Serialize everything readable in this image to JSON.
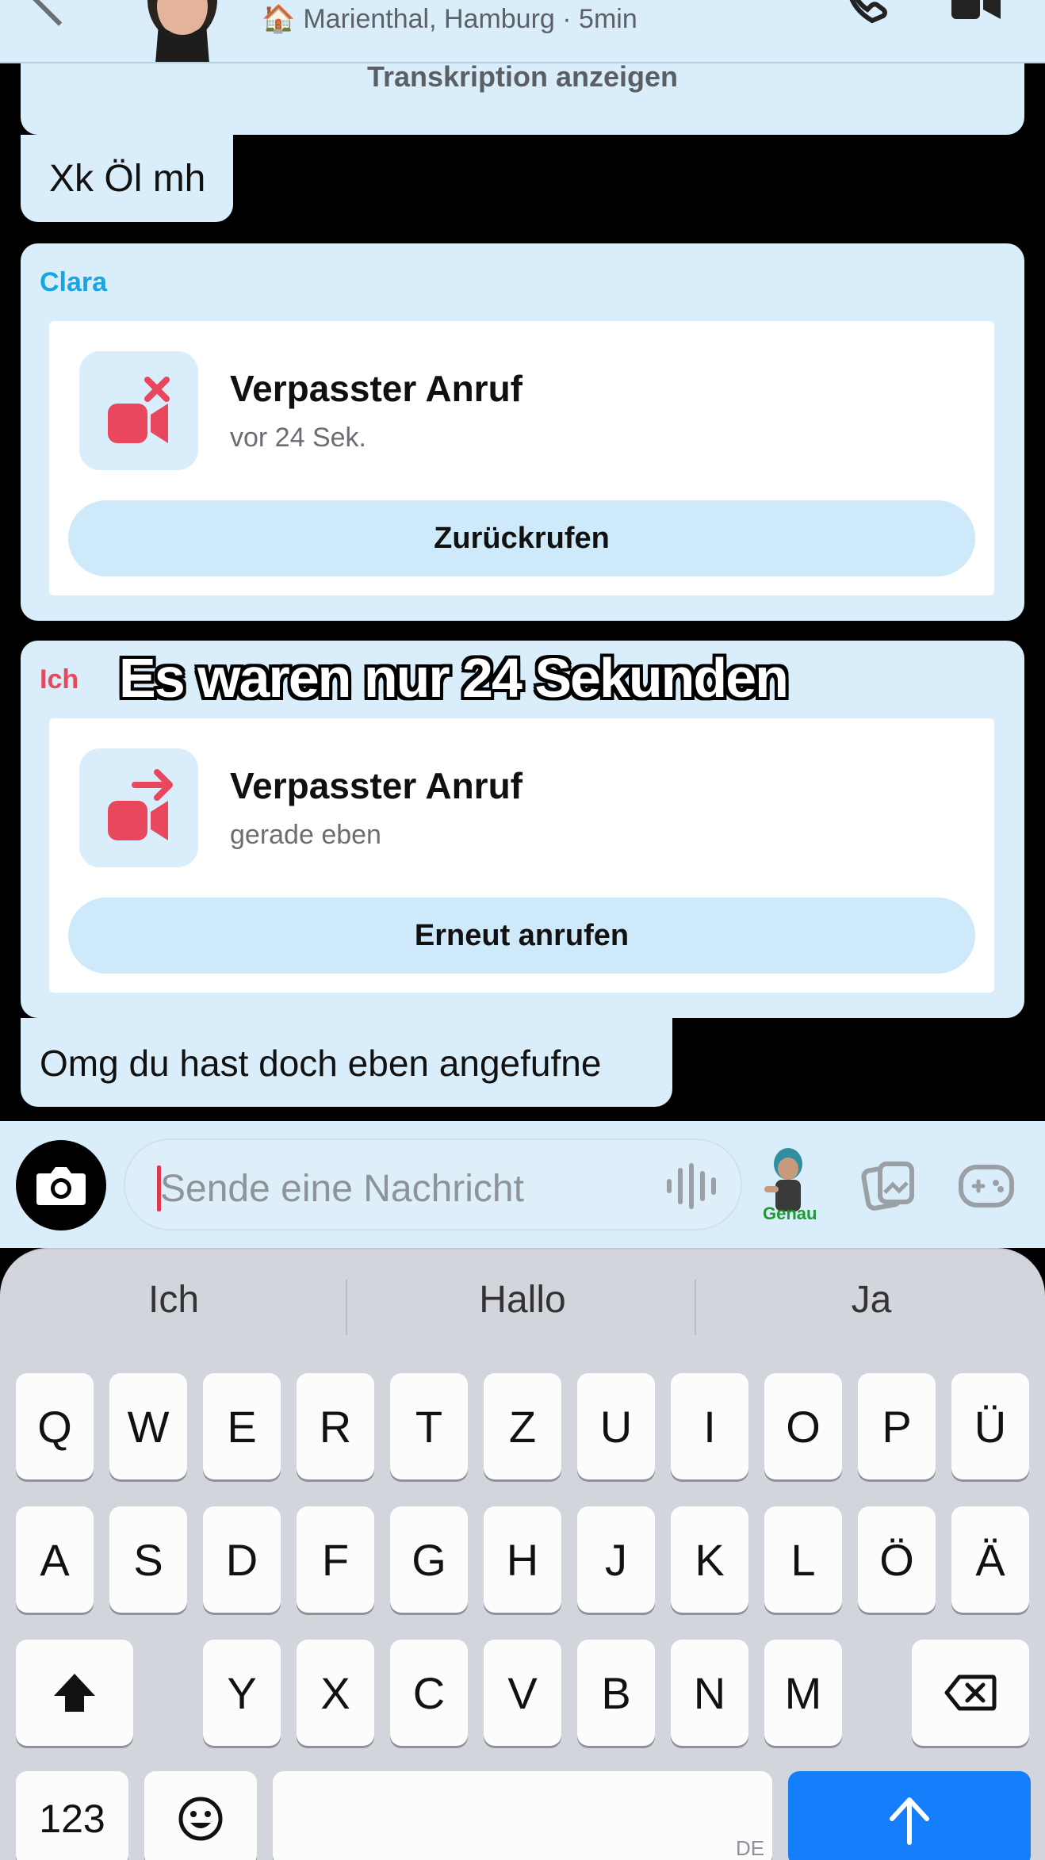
{
  "header": {
    "location": "Marienthal, Hamburg · 5min",
    "house_emoji": "🏠"
  },
  "messages": {
    "transcription_link": "Transkription anzeigen",
    "short_message": "Xk Öl mh",
    "clara_block": {
      "sender": "Clara",
      "sender_color": "#1aa4e0",
      "call_title": "Verpasster Anruf",
      "call_time": "vor 24 Sek.",
      "action": "Zurückrufen",
      "icon": "video-missed-icon"
    },
    "ich_block": {
      "sender": "Ich",
      "sender_color": "#e8475d",
      "call_title": "Verpasster Anruf",
      "call_time": "gerade eben",
      "action": "Erneut anrufen",
      "icon": "video-outgoing-icon"
    },
    "overlay_caption": "Es waren nur 24 Sekunden",
    "last_message": "Omg du hast doch eben angefufne"
  },
  "composer": {
    "placeholder": "Sende eine Nachricht",
    "bitmoji_label": "Genau"
  },
  "keyboard": {
    "suggestions": [
      "Ich",
      "Hallo",
      "Ja"
    ],
    "row1": [
      "Q",
      "W",
      "E",
      "R",
      "T",
      "Z",
      "U",
      "I",
      "O",
      "P",
      "Ü"
    ],
    "row2": [
      "A",
      "S",
      "D",
      "F",
      "G",
      "H",
      "J",
      "K",
      "L",
      "Ö",
      "Ä"
    ],
    "row3": [
      "Y",
      "X",
      "C",
      "V",
      "B",
      "N",
      "M"
    ],
    "numbers_key": "123",
    "language": "DE"
  },
  "colors": {
    "accent_red": "#e8475d",
    "bubble_bg": "#d9eefa",
    "send_blue": "#157efb"
  }
}
